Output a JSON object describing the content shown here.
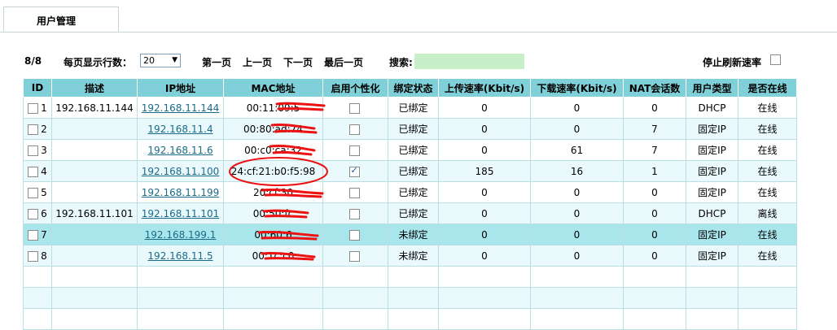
{
  "tab": {
    "label": "用户管理"
  },
  "toolbar": {
    "count": "8/8",
    "perpage_label": "每页显示行数：",
    "perpage_value": "20",
    "first": "第一页",
    "prev": "上一页",
    "next": "下一页",
    "last": "最后一页",
    "search_label": "搜索:",
    "search_value": "",
    "stop_refresh_label": "停止刷新速率"
  },
  "table": {
    "headers": [
      "ID",
      "描述",
      "IP地址",
      "MAC地址",
      "启用个性化",
      "绑定状态",
      "上传速率(Kbit/s)",
      "下载速率(Kbit/s)",
      "NAT会话数",
      "用户类型",
      "是否在线"
    ],
    "rows": [
      {
        "id": "1",
        "desc": "192.168.11.144",
        "ip": "192.168.11.144",
        "mac": "00:11:09:5",
        "custom": false,
        "bind": "已绑定",
        "up": "0",
        "down": "0",
        "nat": "0",
        "type": "DHCP",
        "online": "在线"
      },
      {
        "id": "2",
        "desc": "",
        "ip": "192.168.11.4",
        "mac": "00:80:ad:74",
        "custom": false,
        "bind": "已绑定",
        "up": "0",
        "down": "0",
        "nat": "7",
        "type": "固定IP",
        "online": "在线"
      },
      {
        "id": "3",
        "desc": "",
        "ip": "192.168.11.6",
        "mac": "00:c0:ca:32",
        "custom": false,
        "bind": "已绑定",
        "up": "0",
        "down": "61",
        "nat": "7",
        "type": "固定IP",
        "online": "在线"
      },
      {
        "id": "4",
        "desc": "",
        "ip": "192.168.11.100",
        "mac": "24:cf:21:b0:f5:98",
        "custom": true,
        "bind": "已绑定",
        "up": "185",
        "down": "16",
        "nat": "1",
        "type": "固定IP",
        "online": "在线"
      },
      {
        "id": "5",
        "desc": "",
        "ip": "192.168.11.199",
        "mac": "20:cf:30",
        "custom": false,
        "bind": "已绑定",
        "up": "0",
        "down": "0",
        "nat": "0",
        "type": "固定IP",
        "online": "在线"
      },
      {
        "id": "6",
        "desc": "192.168.11.101",
        "ip": "192.168.11.101",
        "mac": "00:50:fc",
        "custom": false,
        "bind": "已绑定",
        "up": "0",
        "down": "0",
        "nat": "0",
        "type": "DHCP",
        "online": "离线"
      },
      {
        "id": "7",
        "desc": "",
        "ip": "192.168.199.1",
        "mac": "00:60:6",
        "custom": false,
        "bind": "未绑定",
        "up": "0",
        "down": "0",
        "nat": "0",
        "type": "固定IP",
        "online": "在线"
      },
      {
        "id": "8",
        "desc": "",
        "ip": "192.168.11.5",
        "mac": "00:1c:c0",
        "custom": false,
        "bind": "未绑定",
        "up": "0",
        "down": "0",
        "nat": "0",
        "type": "固定IP",
        "online": "在线"
      }
    ]
  }
}
